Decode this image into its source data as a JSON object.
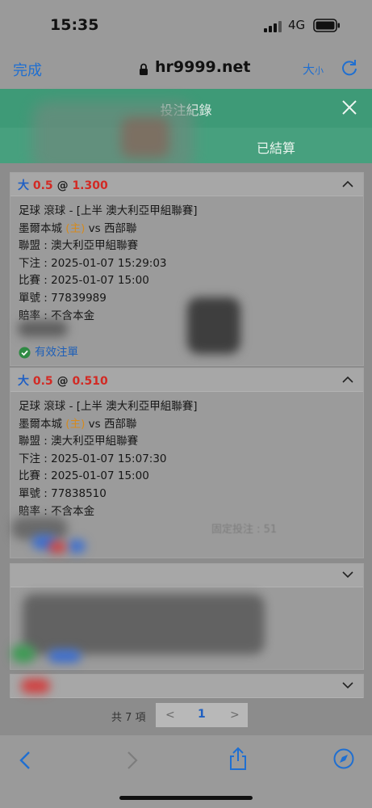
{
  "status_bar": {
    "time": "15:35",
    "network": "4G"
  },
  "browser": {
    "done_label": "完成",
    "url": "hr9999.net",
    "font_size_big": "大",
    "font_size_small": "小"
  },
  "header": {
    "title": "投注紀錄",
    "tab_settled": "已結算"
  },
  "bets": [
    {
      "market_prefix": "大",
      "line": "0.5",
      "at": "@",
      "odds": "1.300",
      "sport_line": "足球 滾球 - [上半 澳大利亞甲組聯賽]",
      "home_team": "墨爾本城",
      "home_tag": "(主)",
      "vs": "vs",
      "away_team": "西部聯",
      "league": "聯盟 : 澳大利亞甲組聯賽",
      "placed": "下注 : 2025-01-07 15:29:03",
      "match_time": "比賽 : 2025-01-07 15:00",
      "ticket": "單號 : 77839989",
      "odds_type": "賠率 : 不含本金",
      "status": "有效注單"
    },
    {
      "market_prefix": "大",
      "line": "0.5",
      "at": "@",
      "odds": "0.510",
      "sport_line": "足球 滾球 - [上半 澳大利亞甲組聯賽]",
      "home_team": "墨爾本城",
      "home_tag": "(主)",
      "vs": "vs",
      "away_team": "西部聯",
      "league": "聯盟 : 澳大利亞甲組聯賽",
      "placed": "下注 : 2025-01-07 15:07:30",
      "match_time": "比賽 : 2025-01-07 15:00",
      "ticket": "單號 : 77838510",
      "odds_type": "賠率 : 不含本金",
      "faint_text": "固定投注 : 51"
    }
  ],
  "pager": {
    "total": "共 7 項",
    "prev": "<",
    "current_page": "1",
    "next": ">"
  },
  "colors": {
    "accent_blue": "#1f6fd1",
    "header_green": "#3e9a77",
    "odds_red": "#d22a24",
    "home_orange": "#d58a1d"
  }
}
